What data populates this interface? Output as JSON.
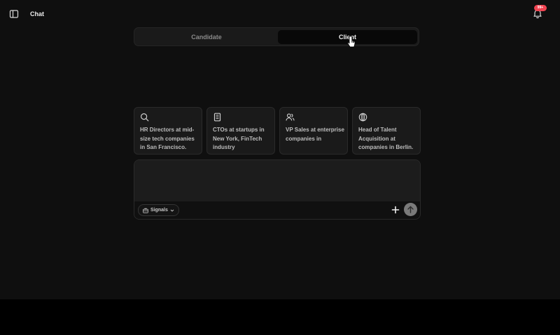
{
  "header": {
    "title": "Chat",
    "notification_badge": "99+",
    "icons": {
      "sidebar": "sidebar-toggle-icon",
      "bell": "bell-icon"
    }
  },
  "tabs": [
    {
      "label": "Candidate",
      "active": false
    },
    {
      "label": "Client",
      "active": true
    }
  ],
  "suggestions": [
    {
      "icon": "search-icon",
      "text": "HR Directors at mid-size tech companies in San Francisco."
    },
    {
      "icon": "building-icon",
      "text": "CTOs at startups in New York, FinTech industry"
    },
    {
      "icon": "users-icon",
      "text": "VP Sales at enterprise companies in"
    },
    {
      "icon": "globe-icon",
      "text": "Head of Talent Acquisition at companies in Berlin."
    }
  ],
  "composer": {
    "value": "",
    "signals_label": "Signals"
  },
  "colors": {
    "background": "#0f0f0f",
    "card": "#1a1a1a",
    "badge": "#f04452",
    "send": "#7a7a7a"
  }
}
